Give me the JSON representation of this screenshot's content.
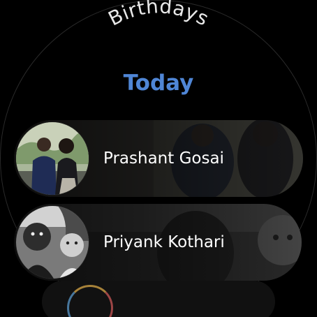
{
  "header": {
    "title": "Birthdays"
  },
  "section": {
    "label": "Today"
  },
  "contacts": [
    {
      "name": "Prashant Gosai"
    },
    {
      "name": "Priyank Kothari"
    }
  ],
  "colors": {
    "background": "#000000",
    "section_accent": "#4f86d6",
    "title_text": "#e8e8e8",
    "name_text": "#ffffff"
  }
}
